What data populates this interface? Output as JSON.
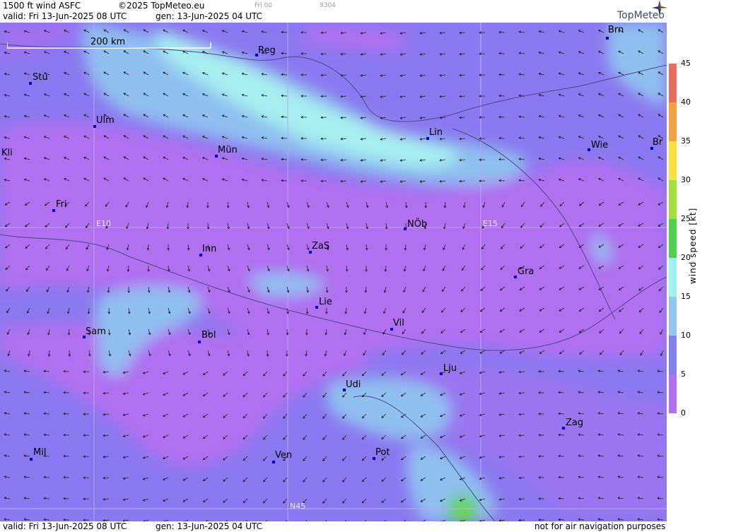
{
  "header": {
    "title": "1500 ft wind ASFC",
    "copyright": "©2025 TopMeteo.eu",
    "run_label": "Fri 00",
    "code": "9304",
    "valid": "valid:  Fri  13-Jun-2025  08 UTC",
    "gen": "gen: 13-Jun-2025 04 UTC",
    "logo": "TopMeteo"
  },
  "footer": {
    "valid": "valid:  Fri  13-Jun-2025  08 UTC",
    "gen": "gen: 13-Jun-2025 04 UTC",
    "disclaimer": "not for air navigation purposes"
  },
  "map": {
    "scale_label": "200 km",
    "grid_labels": [
      {
        "id": "e10",
        "text": "E10"
      },
      {
        "id": "e15",
        "text": "E15"
      },
      {
        "id": "n45",
        "text": "N45"
      }
    ],
    "cities": [
      {
        "name": "Brn"
      },
      {
        "name": "Reg"
      },
      {
        "name": "Stu"
      },
      {
        "name": "Ulm"
      },
      {
        "name": "Lin"
      },
      {
        "name": "Kli"
      },
      {
        "name": "Mün"
      },
      {
        "name": "Wie"
      },
      {
        "name": "Br"
      },
      {
        "name": "Fri"
      },
      {
        "name": "NÖb"
      },
      {
        "name": "Inn"
      },
      {
        "name": "ZaS"
      },
      {
        "name": "Gra"
      },
      {
        "name": "Lie"
      },
      {
        "name": "Sam"
      },
      {
        "name": "Vil"
      },
      {
        "name": "Bol"
      },
      {
        "name": "Lju"
      },
      {
        "name": "Udi"
      },
      {
        "name": "Zag"
      },
      {
        "name": "Mil"
      },
      {
        "name": "Ven"
      },
      {
        "name": "Pot"
      }
    ]
  },
  "legend": {
    "unit_label": "wind  speed  [kt]",
    "ticks": [
      "45",
      "40",
      "35",
      "30",
      "25",
      "20",
      "15",
      "10",
      "5",
      "0"
    ],
    "colors": [
      "#e87060",
      "#f0a040",
      "#f8e040",
      "#a0e040",
      "#50d050",
      "#a0f0f0",
      "#90c8f0",
      "#8080f0",
      "#b070f0"
    ]
  }
}
